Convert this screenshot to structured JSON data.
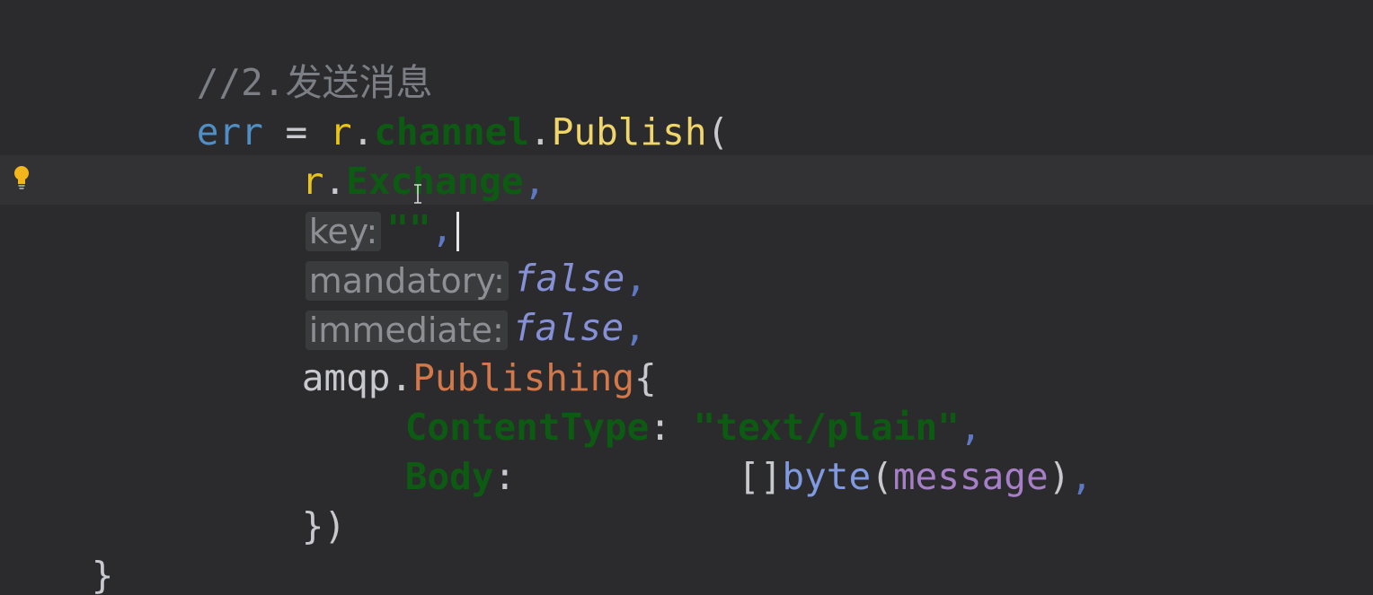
{
  "editor": {
    "lines": {
      "comment": "//2.发送消息",
      "publish": {
        "var": "err",
        "assign": " = ",
        "receiver": "r",
        "dot1": ".",
        "field": "channel",
        "dot2": ".",
        "method": "Publish",
        "open_paren": "("
      },
      "exchange": {
        "receiver": "r",
        "dot": ".",
        "field": "Exchange",
        "comma": ","
      },
      "key": {
        "hint": "key:",
        "value": "\"\"",
        "comma": ","
      },
      "mandatory": {
        "hint": "mandatory:",
        "value": "false",
        "comma": ","
      },
      "immediate": {
        "hint": "immediate:",
        "value": "false",
        "comma": ","
      },
      "publishing": {
        "pkg": "amqp",
        "dot": ".",
        "type": "Publishing",
        "brace": "{"
      },
      "content_type": {
        "field": "ContentType",
        "colon": ": ",
        "value": "\"text/plain\"",
        "comma": ","
      },
      "body": {
        "field": "Body",
        "colon": ":          ",
        "slice": "[]",
        "builtin": "byte",
        "open": "(",
        "arg": "message",
        "close": ")",
        "comma": ","
      },
      "close_call": "})",
      "close_func": "}"
    },
    "icons": {
      "intention_bulb": "lightbulb-icon",
      "text_cursor": "ibeam-cursor-icon"
    }
  }
}
